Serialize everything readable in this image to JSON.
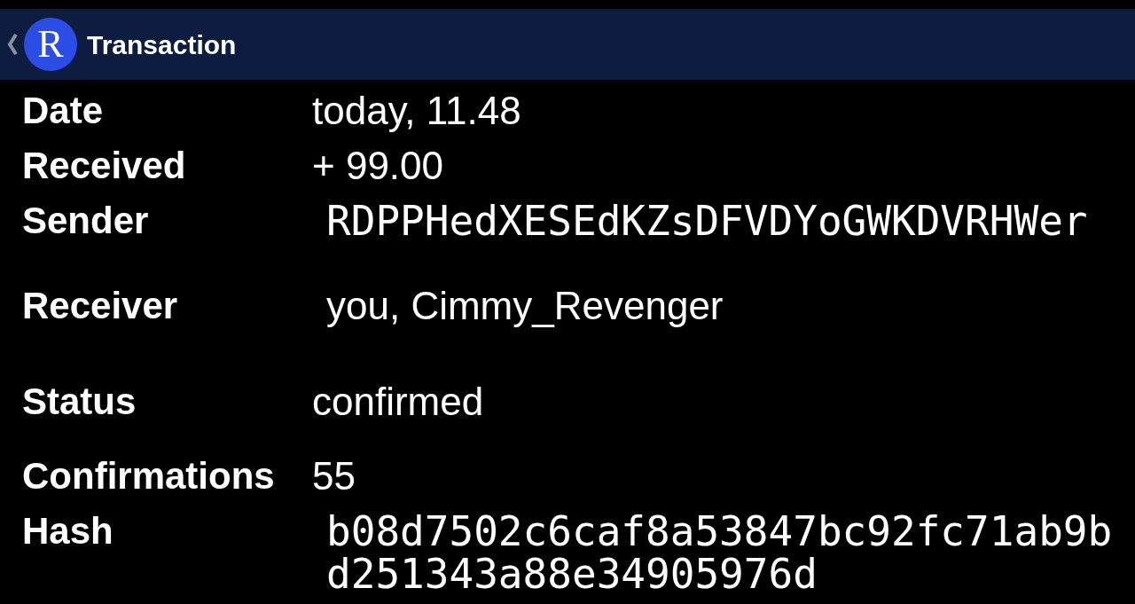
{
  "app_bar": {
    "logo_letter": "R",
    "title": "Transaction"
  },
  "fields": [
    {
      "label": "Date",
      "kind": "plain",
      "value": "today, 11.48"
    },
    {
      "label": "Received",
      "kind": "plain",
      "value": "+ 99.00"
    },
    {
      "label": "Sender",
      "kind": "code",
      "value": "RDPPHedXESEdKZsDFVDYoGWKDVRHWer"
    },
    {
      "label": "Receiver",
      "kind": "account",
      "value": "you, Cimmy_Revenger"
    },
    {
      "label": "Status",
      "kind": "plain",
      "value": "confirmed"
    },
    {
      "label": "Confirmations",
      "kind": "plain",
      "value": "55"
    },
    {
      "label": "Hash",
      "kind": "code",
      "value": "b08d7502c6caf8a53847bc92fc71ab9bd251343a88e34905976d"
    }
  ]
}
